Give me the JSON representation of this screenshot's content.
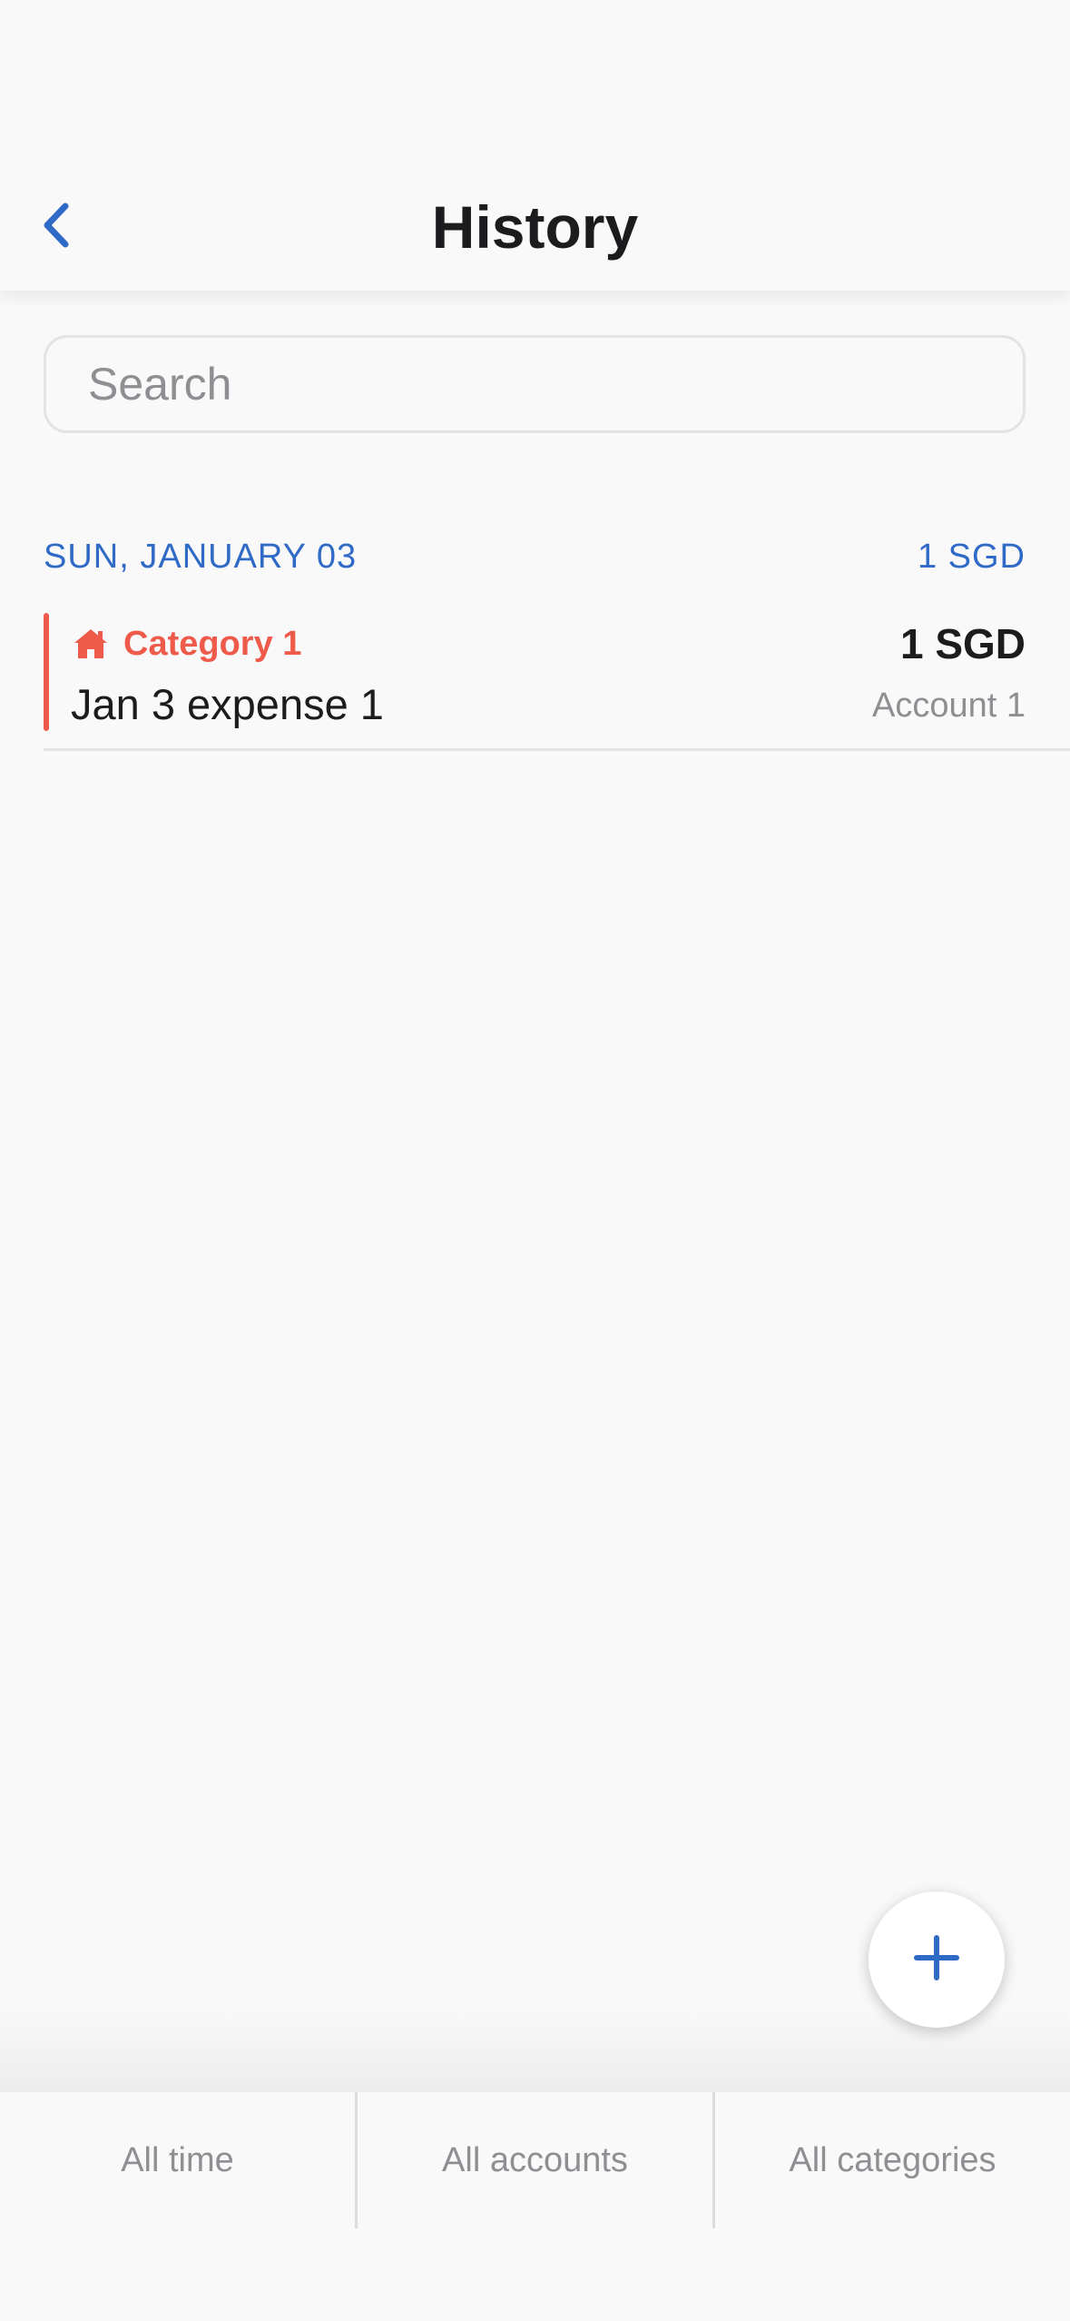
{
  "header": {
    "title": "History",
    "back_icon": "chevron-left-icon"
  },
  "search": {
    "placeholder": "Search",
    "value": ""
  },
  "groups": [
    {
      "date": "SUN, JANUARY 03",
      "total": "1 SGD",
      "transactions": [
        {
          "category": "Category 1",
          "category_icon": "house-icon",
          "category_color": "#ef5b4b",
          "description": "Jan 3 expense 1",
          "amount": "1 SGD",
          "account": "Account 1"
        }
      ]
    }
  ],
  "fab": {
    "icon": "plus-icon"
  },
  "filters": {
    "time": "All time",
    "accounts": "All accounts",
    "categories": "All categories"
  },
  "colors": {
    "accent": "#2f6ac6",
    "category": "#ef5b4b",
    "background": "#f9f9f9",
    "secondary_text": "#8e8e93"
  }
}
